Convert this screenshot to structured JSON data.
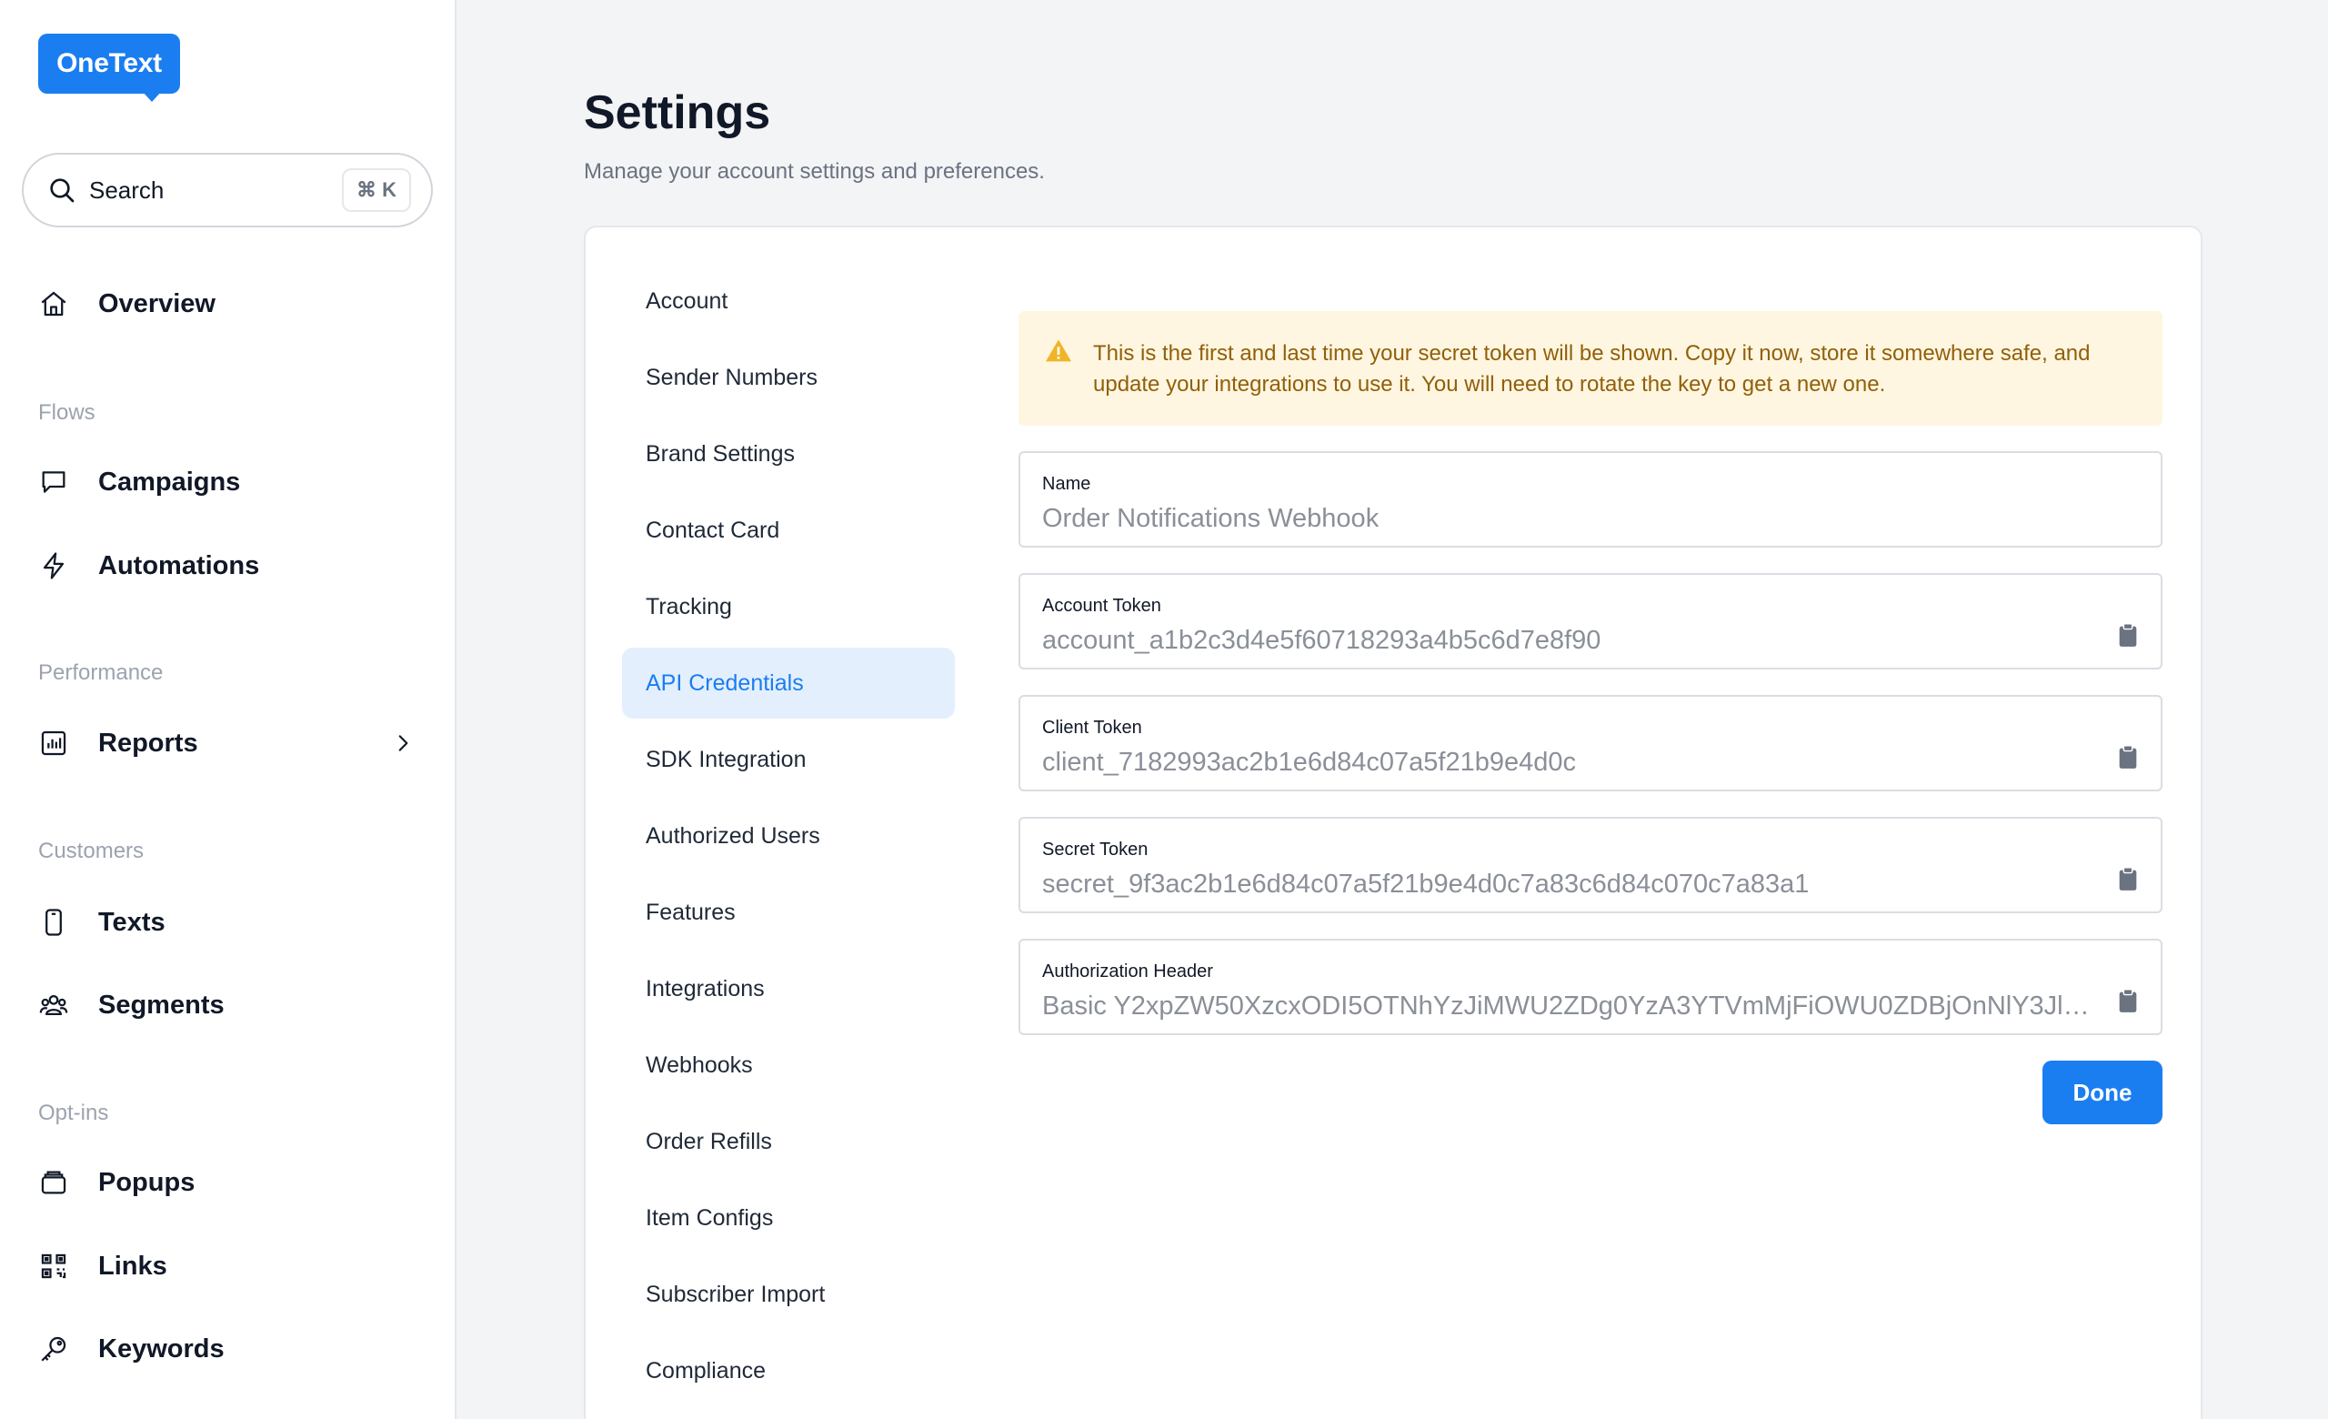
{
  "brand": {
    "name": "OneText"
  },
  "search": {
    "label": "Search",
    "shortcut": "⌘ K"
  },
  "sidebar": {
    "overview": "Overview",
    "sections": {
      "flows": "Flows",
      "performance": "Performance",
      "customers": "Customers",
      "optins": "Opt-ins"
    },
    "items": {
      "campaigns": "Campaigns",
      "automations": "Automations",
      "reports": "Reports",
      "texts": "Texts",
      "segments": "Segments",
      "popups": "Popups",
      "links": "Links",
      "keywords": "Keywords"
    }
  },
  "page": {
    "title": "Settings",
    "subtitle": "Manage your account settings and preferences."
  },
  "settings_nav": [
    {
      "label": "Account",
      "active": false
    },
    {
      "label": "Sender Numbers",
      "active": false
    },
    {
      "label": "Brand Settings",
      "active": false
    },
    {
      "label": "Contact Card",
      "active": false
    },
    {
      "label": "Tracking",
      "active": false
    },
    {
      "label": "API Credentials",
      "active": true
    },
    {
      "label": "SDK Integration",
      "active": false
    },
    {
      "label": "Authorized Users",
      "active": false
    },
    {
      "label": "Features",
      "active": false
    },
    {
      "label": "Integrations",
      "active": false
    },
    {
      "label": "Webhooks",
      "active": false
    },
    {
      "label": "Order Refills",
      "active": false
    },
    {
      "label": "Item Configs",
      "active": false
    },
    {
      "label": "Subscriber Import",
      "active": false
    },
    {
      "label": "Compliance",
      "active": false
    }
  ],
  "warning": {
    "text": "This is the first and last time your secret token will be shown. Copy it now, store it somewhere safe, and update your integrations to use it. You will need to rotate the key to get a new one."
  },
  "fields": {
    "name": {
      "label": "Name",
      "value": "Order Notifications Webhook"
    },
    "account_token": {
      "label": "Account Token",
      "value": "account_a1b2c3d4e5f60718293a4b5c6d7e8f90"
    },
    "client_token": {
      "label": "Client Token",
      "value": "client_7182993ac2b1e6d84c07a5f21b9e4d0c"
    },
    "secret_token": {
      "label": "Secret Token",
      "value": "secret_9f3ac2b1e6d84c07a5f21b9e4d0c7a83c6d84c070c7a83a1"
    },
    "auth_header": {
      "label": "Authorization Header",
      "value": "Basic Y2xpZW50XzcxODI5OTNhYzJiMWU2ZDg0YzA3YTVmMjFiOWU0ZDBjOnNlY3JldF8..."
    }
  },
  "actions": {
    "done": "Done"
  },
  "colors": {
    "accent": "#1a7ef0",
    "warning_bg": "#fef6e0",
    "warning_text": "#925f0a",
    "active_bg": "#e3effd"
  }
}
